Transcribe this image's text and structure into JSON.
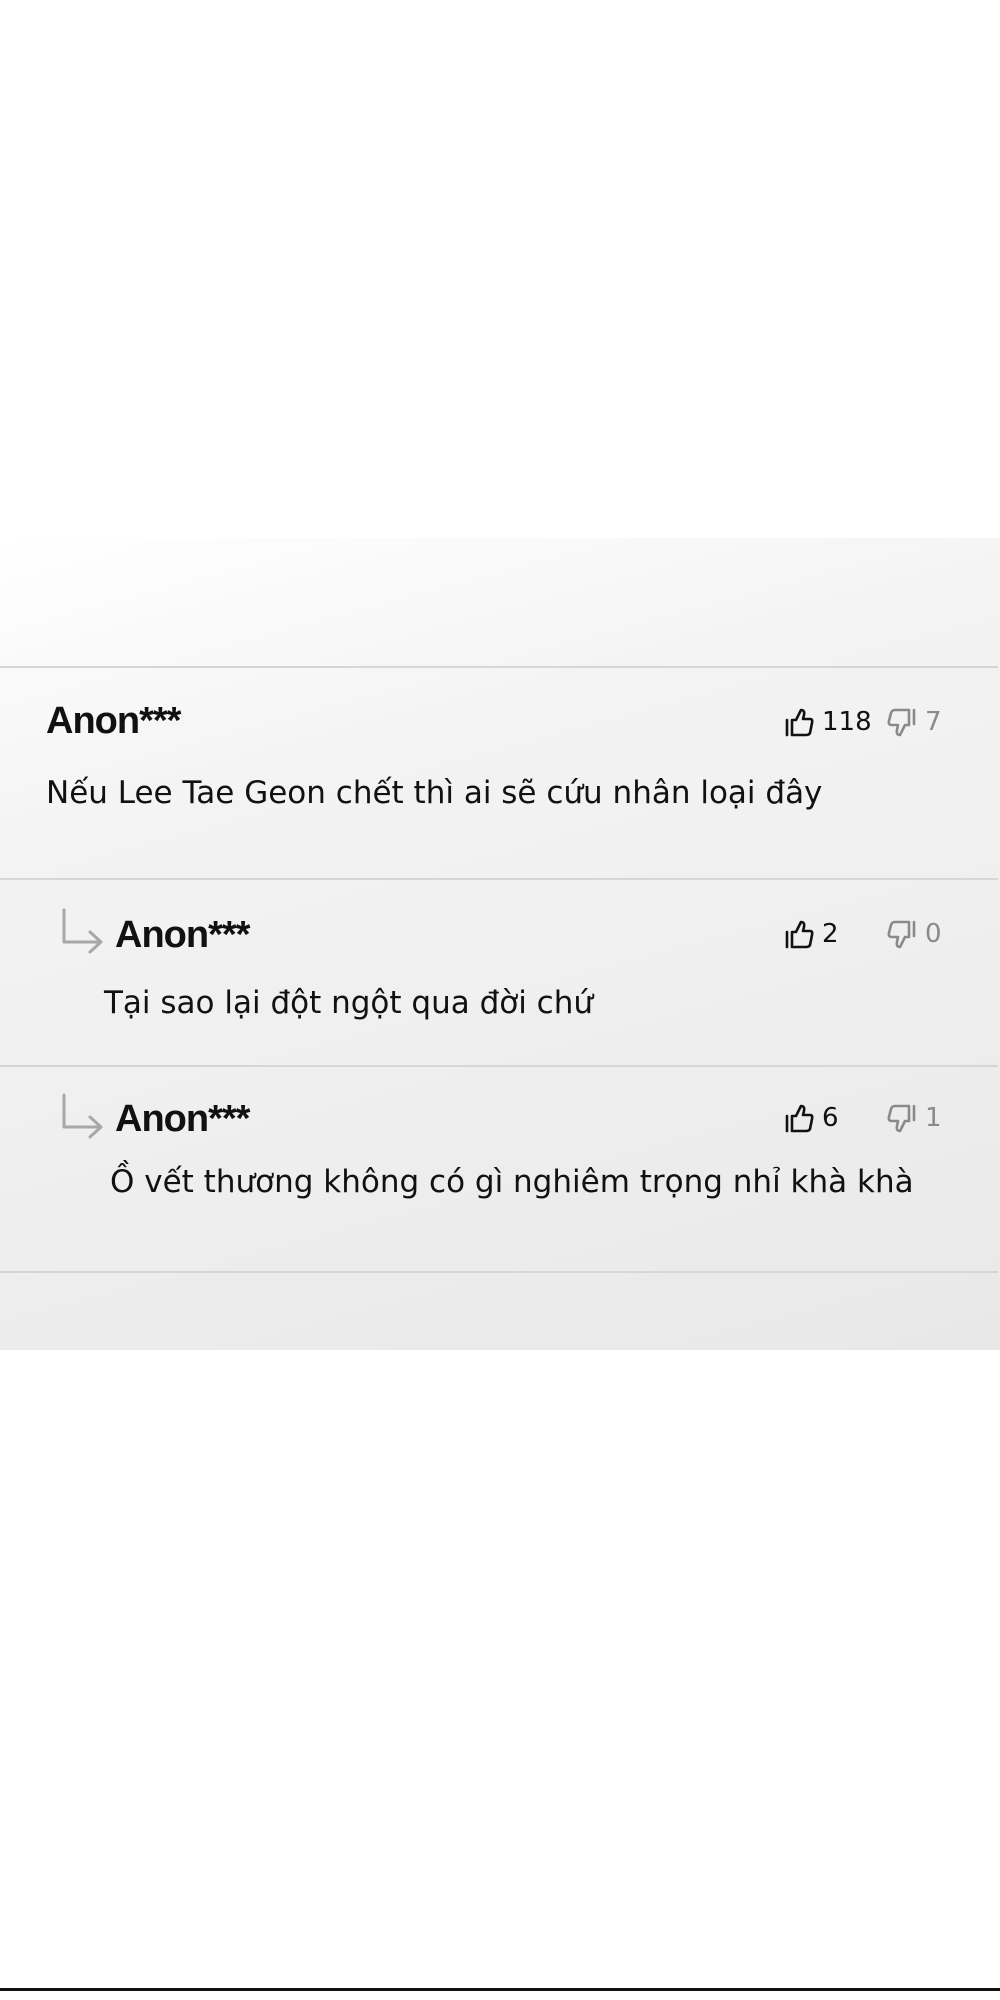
{
  "comments": [
    {
      "author": "Anon***",
      "text": "Nếu Lee Tae Geon chết thì ai sẽ cứu nhân loại đây",
      "likes": "118",
      "dislikes": "7"
    },
    {
      "author": "Anon***",
      "text": "Tại sao lại đột ngột qua đời chứ",
      "likes": "2",
      "dislikes": "0",
      "is_reply": true
    },
    {
      "author": "Anon***",
      "text": "Ồ vết thương không có gì nghiêm trọng nhỉ khà khà",
      "likes": "6",
      "dislikes": "1",
      "is_reply": true
    }
  ],
  "icons": {
    "like": "thumbs-up-icon",
    "dislike": "thumbs-down-icon",
    "reply": "reply-arrow-icon"
  },
  "colors": {
    "text": "#111111",
    "muted": "#8a8a8a",
    "divider": "#d6d6d6"
  }
}
